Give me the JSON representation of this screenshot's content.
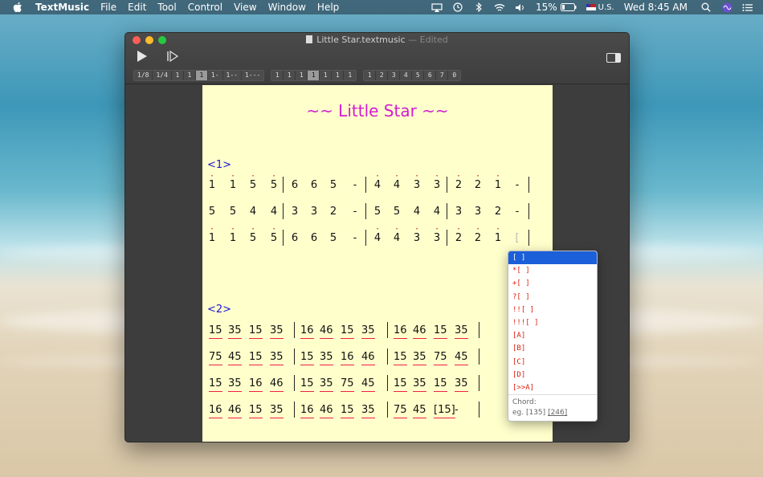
{
  "menubar": {
    "app": "TextMusic",
    "items": [
      "File",
      "Edit",
      "Tool",
      "Control",
      "View",
      "Window",
      "Help"
    ],
    "battery": "15%",
    "input_source": "U.S.",
    "clock": "Wed 8:45 AM"
  },
  "window": {
    "filename": "Little Star.textmusic",
    "status": "— Edited",
    "toolbar_group1": [
      "1/8",
      "1/4",
      "1",
      "1",
      "1",
      "1-",
      "1--",
      "1---"
    ],
    "toolbar_group1_selected": 4,
    "toolbar_group2": [
      "1",
      "1",
      "1",
      "1",
      "1",
      "1",
      "1"
    ],
    "toolbar_group2_selected": 3,
    "toolbar_group3": [
      "1",
      "2",
      "3",
      "4",
      "5",
      "6",
      "7",
      "0"
    ]
  },
  "doc": {
    "title": "~~ Little Star ~~",
    "section1_label": "<1>",
    "section2_label": "<2>",
    "section1_rows": [
      [
        "1",
        "1",
        "5",
        "5",
        "|",
        "6",
        "6",
        "5",
        "-",
        "|",
        "4",
        "4",
        "3",
        "3",
        "|",
        "2",
        "2",
        "1",
        "-",
        "|"
      ],
      [
        "5",
        "5",
        "4",
        "4",
        "|",
        "3",
        "3",
        "2",
        "-",
        "|",
        "5",
        "5",
        "4",
        "4",
        "|",
        "3",
        "3",
        "2",
        "-",
        "|"
      ],
      [
        "1",
        "1",
        "5",
        "5",
        "|",
        "6",
        "6",
        "5",
        "-",
        "|",
        "4",
        "4",
        "3",
        "3",
        "|",
        "2",
        "2",
        "1",
        "[",
        "|"
      ]
    ],
    "section2_rows": [
      [
        "15",
        "35",
        "15",
        "35",
        "|",
        "16",
        "46",
        "15",
        "35",
        "|",
        "16",
        "46",
        "15",
        "35",
        "|"
      ],
      [
        "75",
        "45",
        "15",
        "35",
        "|",
        "15",
        "35",
        "16",
        "46",
        "|",
        "15",
        "35",
        "75",
        "45",
        "|"
      ],
      [
        "15",
        "35",
        "16",
        "46",
        "|",
        "15",
        "35",
        "75",
        "45",
        "|",
        "15",
        "35",
        "15",
        "35",
        "|"
      ],
      [
        "16",
        "46",
        "15",
        "35",
        "|",
        "16",
        "46",
        "15",
        "35",
        "|",
        "75",
        "45",
        "[15]",
        "-",
        "|"
      ]
    ]
  },
  "popup": {
    "items": [
      "[ ]",
      "*[ ]",
      "+[ ]",
      "?[ ]",
      "!![ ]",
      "!!![ ]",
      "[A]",
      "[B]",
      "[C]",
      "[D]",
      "[>>A]"
    ],
    "selected": 0,
    "hint_title": "Chord:",
    "hint_example": "eg. [135]",
    "hint_example2": "[246]"
  }
}
